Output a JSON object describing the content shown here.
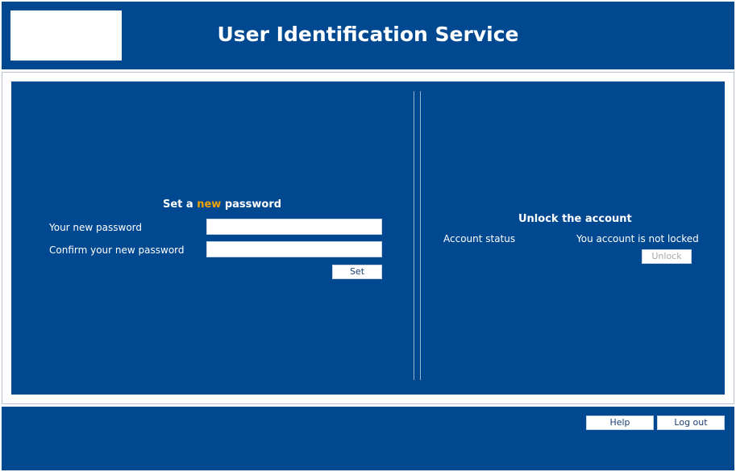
{
  "header": {
    "title": "User Identification Service"
  },
  "password_section": {
    "title_prefix": "Set a ",
    "title_highlight": "new",
    "title_suffix": " password",
    "new_password_label": "Your new password",
    "new_password_value": "",
    "confirm_password_label": "Confirm your new password",
    "confirm_password_value": "",
    "set_button": "Set"
  },
  "unlock_section": {
    "title": "Unlock the account",
    "status_label": "Account status",
    "status_value": "You account is not locked",
    "unlock_button": "Unlock"
  },
  "footer": {
    "help_button": "Help",
    "logout_button": "Log out"
  },
  "colors": {
    "brand_blue": "#004890",
    "accent_orange": "#f5a300",
    "white": "#ffffff"
  }
}
